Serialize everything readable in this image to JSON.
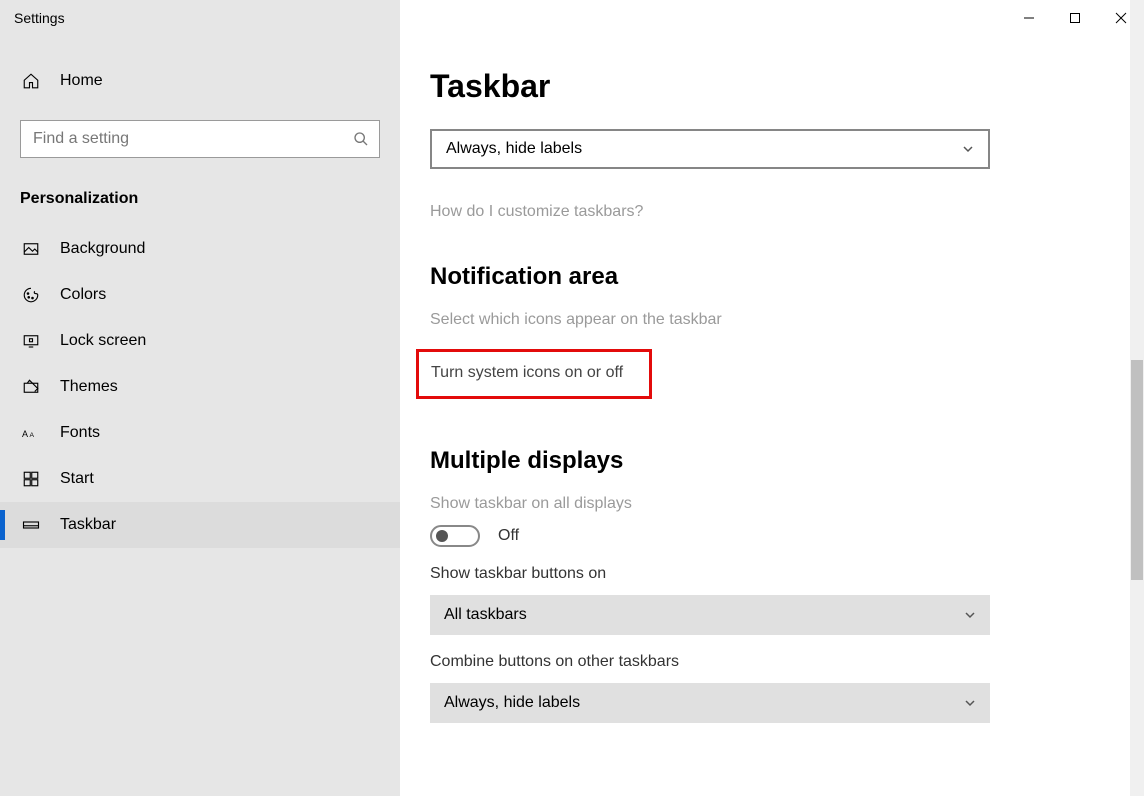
{
  "window": {
    "title": "Settings"
  },
  "sidebar": {
    "home": "Home",
    "search_placeholder": "Find a setting",
    "category": "Personalization",
    "items": [
      {
        "label": "Background"
      },
      {
        "label": "Colors"
      },
      {
        "label": "Lock screen"
      },
      {
        "label": "Themes"
      },
      {
        "label": "Fonts"
      },
      {
        "label": "Start"
      },
      {
        "label": "Taskbar"
      }
    ]
  },
  "main": {
    "title": "Taskbar",
    "combine_value": "Always, hide labels",
    "customize_link": "How do I customize taskbars?",
    "notification_heading": "Notification area",
    "select_icons_link": "Select which icons appear on the taskbar",
    "turn_system_icons_link": "Turn system icons on or off",
    "multiple_displays_heading": "Multiple displays",
    "show_all_label": "Show taskbar on all displays",
    "show_all_state": "Off",
    "show_buttons_label": "Show taskbar buttons on",
    "show_buttons_value": "All taskbars",
    "combine_other_label": "Combine buttons on other taskbars",
    "combine_other_value": "Always, hide labels"
  }
}
